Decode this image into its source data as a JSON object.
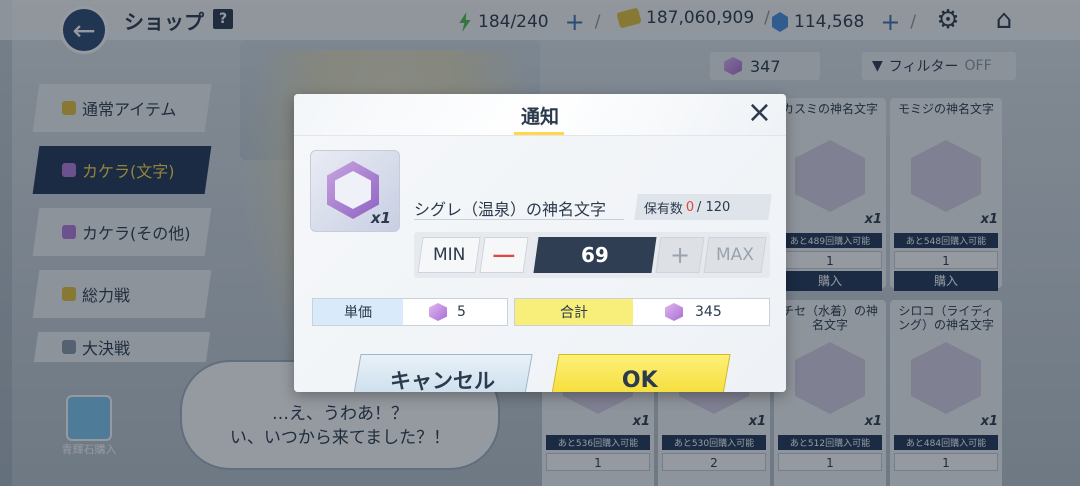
{
  "header": {
    "title": "ショップ",
    "help": "?",
    "ap": "184/240",
    "credits": "187,060,909",
    "pyroxene": "114,568",
    "plus": "+",
    "sep": "/"
  },
  "sidebar": {
    "items": [
      {
        "label": "通常アイテム"
      },
      {
        "label": "カケラ(文字)"
      },
      {
        "label": "カケラ(その他)"
      },
      {
        "label": "総力戦"
      },
      {
        "label": "大決戦"
      }
    ]
  },
  "shop": {
    "currency_amount": "347",
    "filter_label": "フィルター",
    "filter_state": "OFF",
    "cards": [
      {
        "title": "カスミの神名文字",
        "qty": "x1",
        "remain": "あと489回購入可能",
        "count": "1",
        "buy": "購入"
      },
      {
        "title": "モミジの神名文字",
        "qty": "x1",
        "remain": "あと548回購入可能",
        "count": "1",
        "buy": "購入"
      },
      {
        "title": "チセ（水着）の神名文字",
        "qty": "x1",
        "remain": "あと512回購入可能",
        "count": "1"
      },
      {
        "title": "シロコ（ライディング）の神名文字",
        "qty": "x1",
        "remain": "あと484回購入可能",
        "count": "1"
      },
      {
        "remain": "あと536回購入可能",
        "qty": "x1",
        "count": "1"
      },
      {
        "remain": "あと530回購入可能",
        "qty": "x1",
        "count": "2"
      }
    ]
  },
  "speech": {
    "line1": "…え、うわあ！？",
    "line2": "い、いつから来てました？！"
  },
  "gem_shop_label": "青輝石購入",
  "dialog": {
    "title": "通知",
    "close": "×",
    "item_name": "シグレ（温泉）の神名文字",
    "item_qty": "x1",
    "owned_label": "保有数",
    "owned_value": "0",
    "owned_max": "/ 120",
    "min_label": "MIN",
    "minus_label": "ー",
    "quantity": "69",
    "plus_label": "+",
    "max_label": "MAX",
    "unit_price_label": "単価",
    "unit_price": "5",
    "total_label": "合計",
    "total": "345",
    "cancel_label": "キャンセル",
    "ok_label": "OK"
  }
}
